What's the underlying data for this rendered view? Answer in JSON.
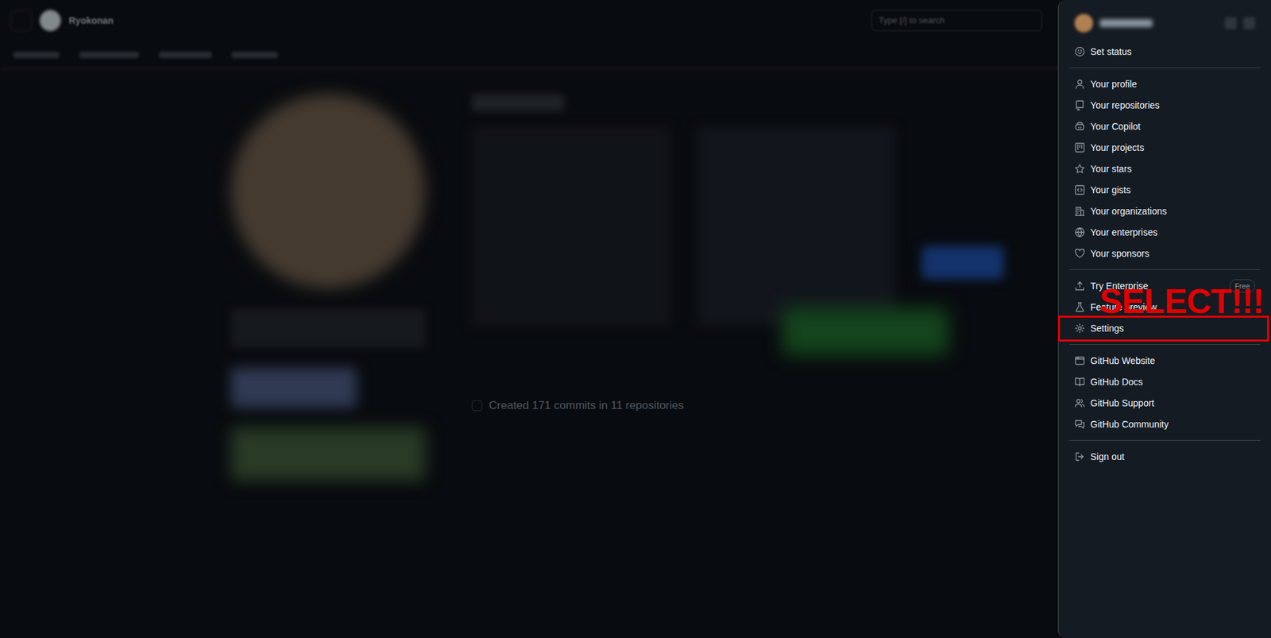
{
  "header": {
    "title": "Ryokonan",
    "search": "Type [/] to search"
  },
  "activity": "Created 171 commits in 11 repositories",
  "menu": {
    "sections": [
      [
        {
          "label": "Set status"
        }
      ],
      [
        {
          "label": "Your profile"
        },
        {
          "label": "Your repositories"
        },
        {
          "label": "Your Copilot"
        },
        {
          "label": "Your projects"
        },
        {
          "label": "Your stars"
        },
        {
          "label": "Your gists"
        },
        {
          "label": "Your organizations"
        },
        {
          "label": "Your enterprises"
        },
        {
          "label": "Your sponsors"
        }
      ],
      [
        {
          "label": "Try Enterprise",
          "badge": "Free"
        },
        {
          "label": "Feature preview"
        },
        {
          "label": "Settings"
        }
      ],
      [
        {
          "label": "GitHub Website"
        },
        {
          "label": "GitHub Docs"
        },
        {
          "label": "GitHub Support"
        },
        {
          "label": "GitHub Community"
        }
      ],
      [
        {
          "label": "Sign out"
        }
      ]
    ]
  },
  "annotation": {
    "text": "SELECT!!!"
  }
}
